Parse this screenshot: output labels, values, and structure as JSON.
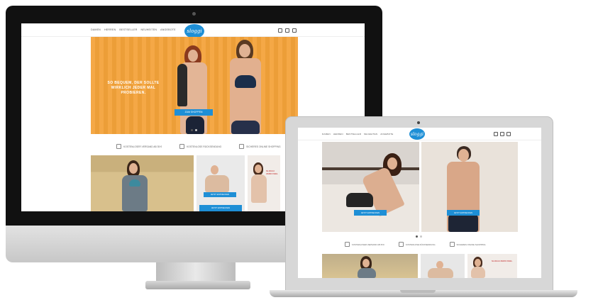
{
  "brand": {
    "logo_text": "sloggi",
    "accent": "#1e8fd6"
  },
  "nav": {
    "items": [
      "DAMEN",
      "HERREN",
      "BESTSELLER",
      "NEUHEITEN",
      "ANGEBOTE"
    ]
  },
  "header_icons": [
    "account-icon",
    "wishlist-icon",
    "cart-icon"
  ],
  "desktop": {
    "hero": {
      "headline_line1": "SO BEQUEM, DER SOLLTE",
      "headline_line2": "WIRKLICH JEDER MAL",
      "headline_line3": "PROBIEREN.",
      "cta": "ZUM SHOPPEN",
      "background": "#f4a33a"
    },
    "features": [
      "KOSTENLOSER VERSAND AB 35 €",
      "KOSTENLOSE RÜCKSENDUNG",
      "SICHERES ONLINE SHOPPING"
    ],
    "tiles": [
      {
        "cta": "JETZT ENTDECKEN"
      },
      {
        "cta": "JETZT ENTDECKEN"
      },
      {
        "text": "SLOGGI ZERO FEEL"
      }
    ]
  },
  "laptop": {
    "hero": {
      "cta_left": "JETZT ENTDECKEN",
      "cta_right": "JETZT ENTDECKEN"
    },
    "features": [
      "KOSTENLOSER VERSAND AB 35 €",
      "KOSTENLOSE RÜCKSENDUNG",
      "SICHERES ONLINE SHOPPING"
    ],
    "tiles": [
      {
        "text": ""
      },
      {
        "text": ""
      },
      {
        "text": "SLOGGI ZERO FEEL"
      }
    ]
  }
}
